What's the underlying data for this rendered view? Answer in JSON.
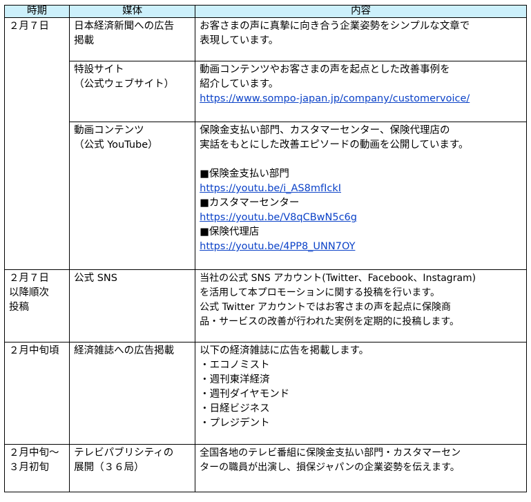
{
  "headers": {
    "period": "時期",
    "media": "媒体",
    "content": "内容"
  },
  "rows": [
    {
      "period": [
        "２月７日"
      ],
      "media": [
        "日本経済新聞への広告",
        "掲載"
      ],
      "content": [
        "お客さまの声に真摯に向き合う企業姿勢をシンプルな文章で",
        "表現しています。"
      ],
      "links": []
    },
    {
      "period": [],
      "media": [
        "特設サイト",
        "（公式ウェブサイト）"
      ],
      "content": [
        "動画コンテンツやお客さまの声を起点とした改善事例を",
        "紹介しています。"
      ],
      "links": [
        "https://www.sompo-japan.jp/company/customervoice/"
      ]
    },
    {
      "period": [],
      "media": [
        "動画コンテンツ",
        "（公式 YouTube）"
      ],
      "content": [
        "保険金支払い部門、カスタマーセンター、保険代理店の",
        "実話をもとにした改善エピソードの動画を公開しています。"
      ],
      "sub": [
        {
          "label": "■保険金支払い部門",
          "link": "https://youtu.be/i_AS8mfIckI"
        },
        {
          "label": "■カスタマーセンター",
          "link": "https://youtu.be/V8qCBwN5c6g"
        },
        {
          "label": "■保険代理店",
          "link": "https://youtu.be/4PP8_UNN7OY"
        }
      ]
    },
    {
      "period": [
        "２月７日",
        "以降順次",
        "投稿"
      ],
      "media": [
        "公式 SNS"
      ],
      "content": [
        "当社の公式 SNS アカウント(Twitter、Facebook、Instagram)",
        "を活用して本プロモーションに関する投稿を行います。",
        "公式 Twitter アカウントではお客さまの声を起点に保険商",
        "品・サービスの改善が行われた実例を定期的に投稿します。"
      ]
    },
    {
      "period": [
        "２月中旬頃"
      ],
      "media": [
        "経済雑誌への広告掲載"
      ],
      "content": [
        "以下の経済雑誌に広告を掲載します。",
        "・エコノミスト",
        "・週刊東洋経済",
        "・週刊ダイヤモンド",
        "・日経ビジネス",
        "・プレジデント"
      ]
    },
    {
      "period": [
        "２月中旬～",
        "３月初旬"
      ],
      "media": [
        "テレビパブリシティの",
        "展開（３６局）"
      ],
      "content": [
        "全国各地のテレビ番組に保険金支払い部門・カスタマーセン",
        "ターの職員が出演し、損保ジャパンの企業姿勢を伝えます。"
      ]
    }
  ]
}
